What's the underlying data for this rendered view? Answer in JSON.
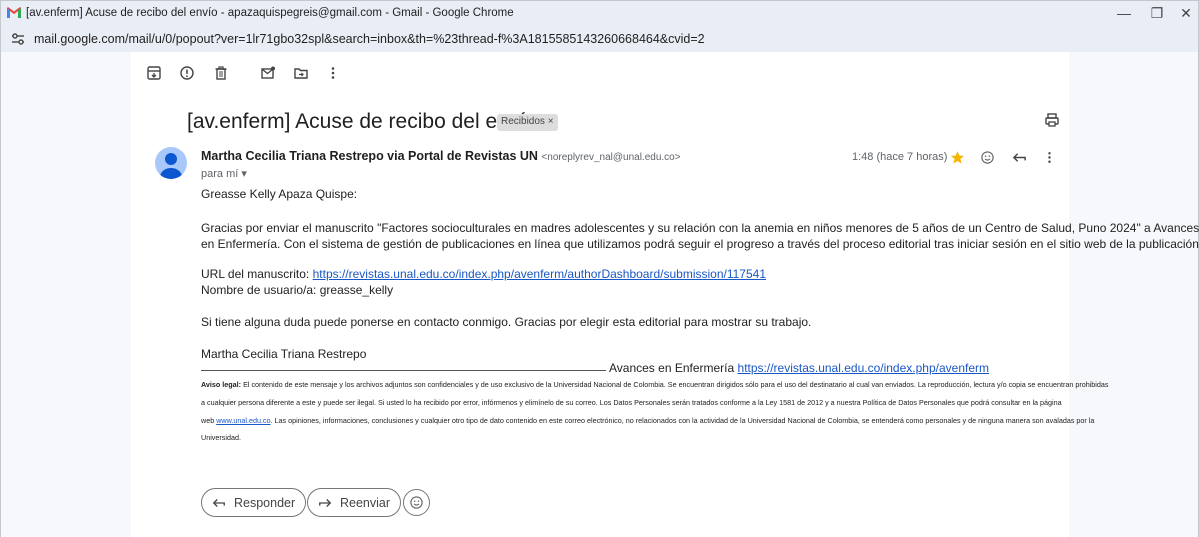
{
  "window": {
    "title": "[av.enferm] Acuse de recibo del envío - apazaquispegreis@gmail.com - Gmail - Google Chrome",
    "url": "mail.google.com/mail/u/0/popout?ver=1lr71gbo32spl&search=inbox&th=%23thread-f%3A1815585143260668464&cvid=2",
    "minimize": "—",
    "restore": "❐",
    "close": "✕"
  },
  "toolbar": {
    "icons": [
      "archive-icon",
      "report-spam-icon",
      "delete-icon",
      "mark-unread-icon",
      "move-to-icon",
      "more-icon"
    ]
  },
  "email": {
    "subject": "[av.enferm] Acuse de recibo del envío",
    "label": "Recibidos ×",
    "sender_name": "Martha Cecilia Triana Restrepo via Portal de Revistas UN",
    "sender_email": "<noreplyrev_nal@unal.edu.co>",
    "to": "para mí ▾",
    "date": "1:48 (hace 7 horas)",
    "greeting": "Greasse Kelly Apaza Quispe:",
    "para1_line1": "Gracias por enviar el manuscrito \"Factores socioculturales en madres adolescentes y su relación con la anemia en niños menores de 5 años de un Centro de Salud, Puno 2024\" a Avances",
    "para1_line2": "en Enfermería. Con el sistema de gestión de publicaciones en línea que utilizamos podrá seguir el progreso a través del proceso editorial tras iniciar sesión en el sitio web de la publicación:",
    "url_label": "URL del manuscrito: ",
    "url_link": "https://revistas.unal.edu.co/index.php/avenferm/authorDashboard/submission/117541",
    "username_line": "Nombre de usuario/a: greasse_kelly",
    "para2": "Si tiene alguna duda puede ponerse en contacto conmigo. Gracias por elegir esta editorial para mostrar su trabajo.",
    "signature_name": "Martha Cecilia Triana Restrepo",
    "journal_label": "Avances en Enfermería ",
    "journal_link": "https://revistas.unal.edu.co/index.php/avenferm",
    "legal_bold": "Aviso legal:",
    "legal_line1": " El contenido de este mensaje y los archivos adjuntos son confidenciales y de uso exclusivo de la Universidad Nacional de Colombia. Se encuentran dirigidos sólo para el uso del destinatario al cual van enviados. La reproducción, lectura y/o copia se encuentran prohibidas",
    "legal_line2": "a cualquier persona diferente a este y puede ser ilegal. Si usted lo ha recibido por error, infórmenos y elimínelo de su correo. Los Datos Personales serán tratados conforme a la Ley 1581 de 2012 y a nuestra Política de Datos Personales que podrá consultar en la página",
    "legal_web": "web ",
    "legal_link": "www.unal.edu.co",
    "legal_line3_rest": ". Las opiniones, informaciones, conclusiones y cualquier otro tipo de dato contenido en este correo electrónico, no relacionados con la actividad de la Universidad Nacional de Colombia, se entenderá como personales y de ninguna manera son avaladas por la",
    "legal_line4": "Universidad."
  },
  "actions": {
    "reply": "Responder",
    "forward": "Reenviar"
  }
}
